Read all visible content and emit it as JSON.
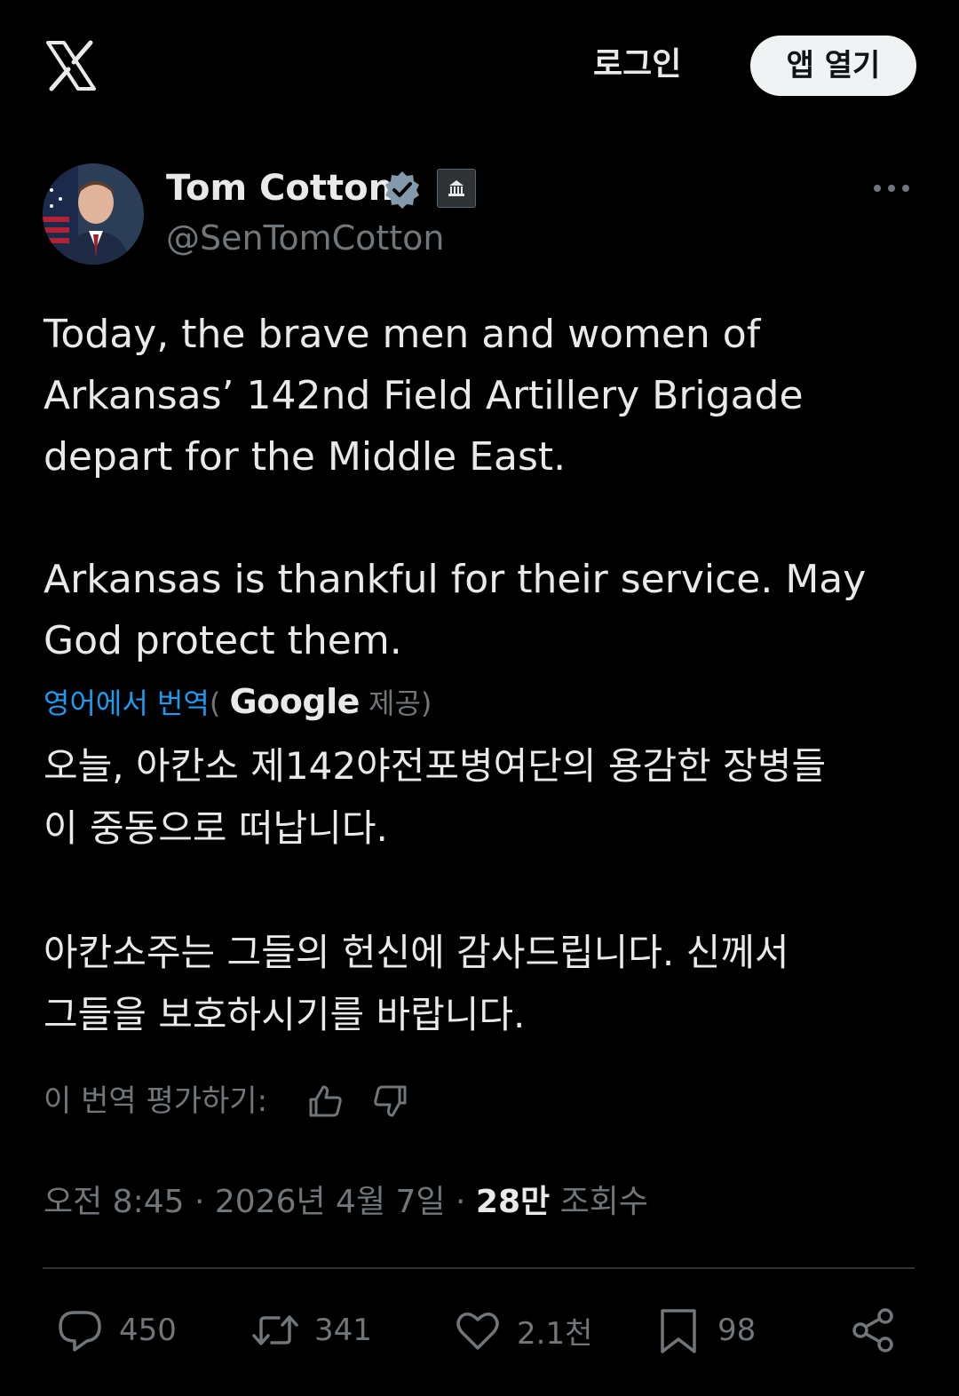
{
  "header": {
    "logo_icon": "x-logo-icon",
    "login_label": "로그인",
    "open_app_label": "앱 열기"
  },
  "author": {
    "name": "Tom Cotton",
    "handle": "@SenTomCotton",
    "verified_icon": "verified-badge-icon",
    "affiliation_icon": "government-building-icon",
    "more_icon": "more-icon"
  },
  "tweet": {
    "lines_p1": [
      "Today, the brave men and women of",
      "Arkansas’ 142nd Field Artillery Brigade",
      "depart for the Middle East."
    ],
    "lines_p2": [
      "Arkansas is thankful for their service. May",
      "God protect them."
    ]
  },
  "translation": {
    "link_label": "영어에서 번역",
    "open_paren": "(",
    "provider": "Google",
    "provided_label": "제공)",
    "lines_p1": [
      "오늘, 아칸소 제142야전포병여단의 용감한 장병들",
      "이 중동으로 떠납니다."
    ],
    "lines_p2": [
      "아칸소주는 그들의 헌신에 감사드립니다. 신께서",
      "그들을 보호하시기를 바랍니다."
    ],
    "rate_label": "이 번역 평가하기:"
  },
  "meta": {
    "time": "오전 8:45",
    "sep1": " · ",
    "date": "2026년 4월 7일",
    "sep2": " · ",
    "views_count": "28만",
    "views_label": "조회수"
  },
  "actions": {
    "reply_count": "450",
    "retweet_count": "341",
    "like_count": "2.1천",
    "bookmark_count": "98"
  },
  "colors": {
    "background": "#000000",
    "text": "#e7e9ea",
    "secondary": "#71767b",
    "link": "#1d9bf0",
    "verified": "#829aab"
  }
}
